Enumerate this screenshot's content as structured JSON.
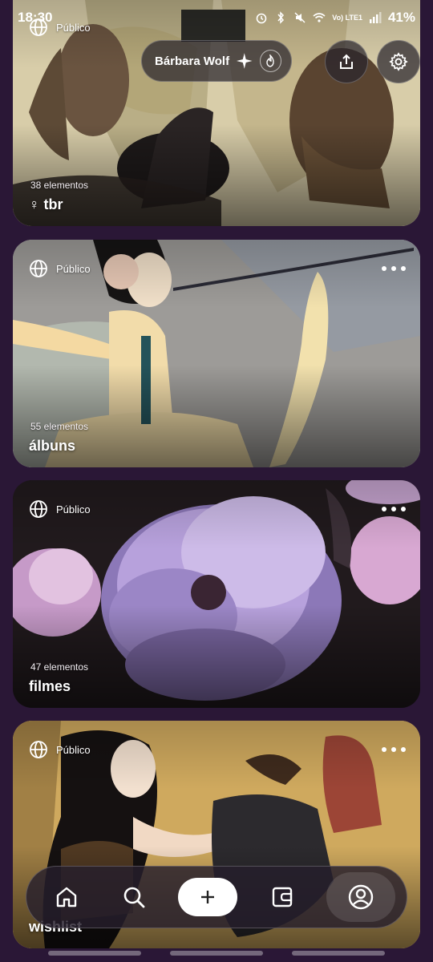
{
  "status_bar": {
    "time": "18:30",
    "network": "Vo) LTE1",
    "battery": "41%"
  },
  "header": {
    "profile_name": "Bárbara Wolf",
    "share_icon": "share-icon",
    "settings_icon": "gear-icon"
  },
  "lists": [
    {
      "visibility": "Público",
      "count": "38 elementos",
      "title": "♀ tbr",
      "colors": [
        "#d6c9a4",
        "#6b5a3f"
      ]
    },
    {
      "visibility": "Público",
      "count": "55 elementos",
      "title": "álbuns",
      "colors": [
        "#9c9a98",
        "#e8d8b0"
      ]
    },
    {
      "visibility": "Público",
      "count": "47 elementos",
      "title": "filmes",
      "colors": [
        "#1c1519",
        "#b89ad8"
      ]
    },
    {
      "visibility": "Público",
      "count": "",
      "title": "wishlist",
      "colors": [
        "#d9b56a",
        "#3a2a22"
      ]
    }
  ],
  "bottom_nav": {
    "items": [
      "home-icon",
      "search-icon",
      "plus-icon",
      "wallet-icon",
      "profile-icon"
    ]
  }
}
